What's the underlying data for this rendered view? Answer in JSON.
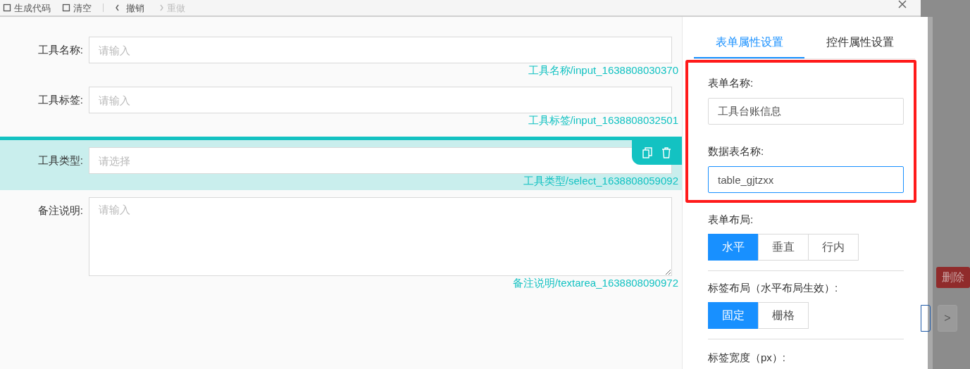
{
  "toolbar": {
    "items": [
      {
        "kind": "icon-text",
        "label": "生成代码",
        "disabled": false
      },
      {
        "kind": "icon-text",
        "label": "清空",
        "disabled": false
      },
      {
        "kind": "divider"
      },
      {
        "kind": "undo",
        "label": "撤销",
        "disabled": false
      },
      {
        "kind": "redo",
        "label": "重做",
        "disabled": true
      }
    ]
  },
  "form": {
    "fields": [
      {
        "label": "工具名称:",
        "kind": "input",
        "placeholder": "请输入",
        "caption": "工具名称/input_1638808030370",
        "selected": false
      },
      {
        "label": "工具标签:",
        "kind": "input",
        "placeholder": "请输入",
        "caption": "工具标签/input_1638808032501",
        "selected": false
      },
      {
        "label": "工具类型:",
        "kind": "select",
        "placeholder": "请选择",
        "caption": "工具类型/select_1638808059092",
        "selected": true
      },
      {
        "label": "备注说明:",
        "kind": "textarea",
        "placeholder": "请输入",
        "caption": "备注说明/textarea_1638808090972",
        "selected": false
      }
    ]
  },
  "panel": {
    "tabs": [
      {
        "label": "表单属性设置",
        "selected": true
      },
      {
        "label": "控件属性设置",
        "selected": false
      }
    ],
    "settings": [
      {
        "kind": "text",
        "label": "表单名称:",
        "value": "工具台账信息",
        "focused": false
      },
      {
        "kind": "text",
        "label": "数据表名称:",
        "value": "table_gjtzxx",
        "focused": true
      },
      {
        "kind": "radio",
        "label": "表单布局:",
        "options": [
          {
            "label": "水平",
            "selected": true
          },
          {
            "label": "垂直",
            "selected": false
          },
          {
            "label": "行内",
            "selected": false
          }
        ]
      },
      {
        "kind": "radio",
        "label": "标签布局（水平布局生效）:",
        "options": [
          {
            "label": "固定",
            "selected": true
          },
          {
            "label": "栅格",
            "selected": false
          }
        ]
      },
      {
        "kind": "heading",
        "label": "标签宽度（px）:"
      }
    ]
  },
  "backdrop": {
    "delete_button": "删除",
    "next_button": ">"
  }
}
